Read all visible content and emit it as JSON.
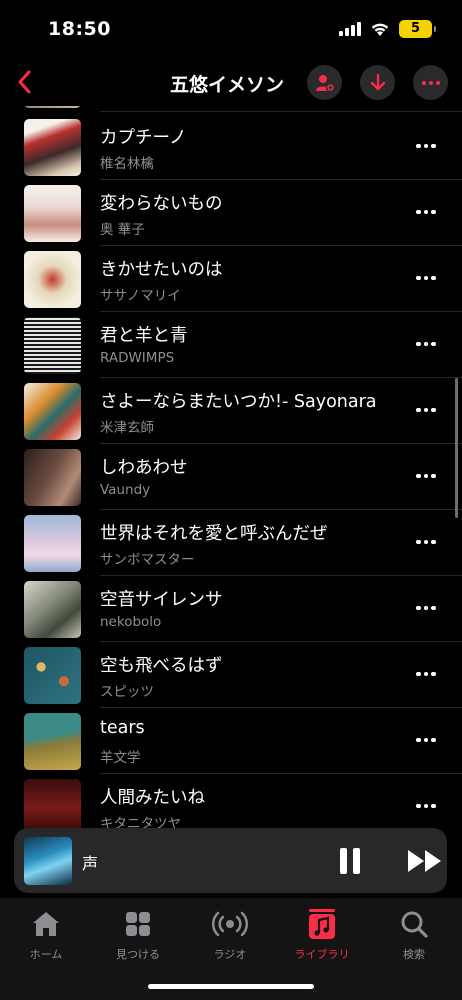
{
  "status_bar": {
    "time": "18:50",
    "battery": "5"
  },
  "nav": {
    "title": "五悠イメソン",
    "back_icon": "chevron-left-icon",
    "actions": [
      "add-person-icon",
      "download-icon",
      "more-icon"
    ]
  },
  "songs": [
    {
      "title": "カプチーノ",
      "artist": "椎名林檎"
    },
    {
      "title": "変わらないもの",
      "artist": "奥 華子"
    },
    {
      "title": "きかせたいのは",
      "artist": "ササノマリイ"
    },
    {
      "title": "君と羊と青",
      "artist": "RADWIMPS"
    },
    {
      "title": "さよーならまたいつか!- Sayonara",
      "artist": "米津玄師"
    },
    {
      "title": "しわあわせ",
      "artist": "Vaundy"
    },
    {
      "title": "世界はそれを愛と呼ぶんだぜ",
      "artist": "サンボマスター"
    },
    {
      "title": "空音サイレンサ",
      "artist": "nekobolo"
    },
    {
      "title": "空も飛べるはず",
      "artist": "スピッツ"
    },
    {
      "title": "tears",
      "artist": "羊文学"
    },
    {
      "title": "人間みたいね",
      "artist": "キタニタツヤ"
    }
  ],
  "now_playing": {
    "title": "声"
  },
  "tabs": [
    {
      "label": "ホーム",
      "icon": "home-icon"
    },
    {
      "label": "見つける",
      "icon": "grid-icon"
    },
    {
      "label": "ラジオ",
      "icon": "radio-icon"
    },
    {
      "label": "ライブラリ",
      "icon": "music-note-icon",
      "active": true
    },
    {
      "label": "検索",
      "icon": "search-icon"
    }
  ],
  "colors": {
    "accent": "#fa2d48",
    "background": "#000000",
    "secondary_text": "#8d8d93"
  }
}
